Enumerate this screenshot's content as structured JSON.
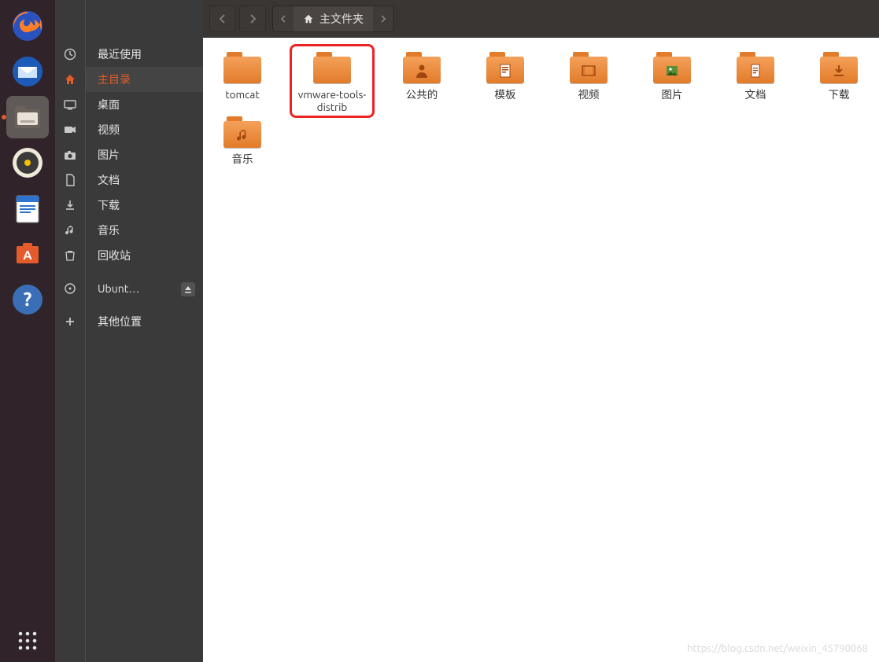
{
  "colors": {
    "accent": "#e25c26",
    "folder_light": "#f4a15a",
    "folder_dark": "#e27b2a",
    "highlight": "#ea2323"
  },
  "dock": [
    {
      "name": "firefox",
      "active": false,
      "running": false
    },
    {
      "name": "thunderbird",
      "active": false,
      "running": false
    },
    {
      "name": "files",
      "active": true,
      "running": true
    },
    {
      "name": "rhythmbox",
      "active": false,
      "running": false
    },
    {
      "name": "libreoffice-writer",
      "active": false,
      "running": false
    },
    {
      "name": "ubuntu-software",
      "active": false,
      "running": false
    },
    {
      "name": "help",
      "active": false,
      "running": false
    }
  ],
  "places": [
    {
      "icon": "clock",
      "label": "最近使用",
      "selected": false
    },
    {
      "icon": "home",
      "label": "主目录",
      "selected": true
    },
    {
      "icon": "desktop",
      "label": "桌面",
      "selected": false
    },
    {
      "icon": "video",
      "label": "视频",
      "selected": false
    },
    {
      "icon": "camera",
      "label": "图片",
      "selected": false
    },
    {
      "icon": "doc",
      "label": "文档",
      "selected": false
    },
    {
      "icon": "download",
      "label": "下载",
      "selected": false
    },
    {
      "icon": "music",
      "label": "音乐",
      "selected": false
    },
    {
      "icon": "trash",
      "label": "回收站",
      "selected": false
    },
    {
      "icon": "disc",
      "label": "Ubunt…",
      "selected": false,
      "ejectable": true
    },
    {
      "icon": "plus",
      "label": "其他位置",
      "selected": false
    }
  ],
  "toolbar": {
    "back_enabled": false,
    "forward_enabled": false
  },
  "breadcrumb": {
    "label": "主文件夹"
  },
  "files": [
    {
      "name": "tomcat",
      "variant": "plain",
      "highlighted": false
    },
    {
      "name": "vmware-tools-distrib",
      "variant": "plain",
      "highlighted": true
    },
    {
      "name": "公共的",
      "variant": "public",
      "highlighted": false
    },
    {
      "name": "模板",
      "variant": "template",
      "highlighted": false
    },
    {
      "name": "视频",
      "variant": "video",
      "highlighted": false
    },
    {
      "name": "图片",
      "variant": "picture",
      "highlighted": false
    },
    {
      "name": "文档",
      "variant": "doc",
      "highlighted": false
    },
    {
      "name": "下载",
      "variant": "download",
      "highlighted": false
    },
    {
      "name": "音乐",
      "variant": "music",
      "highlighted": false
    }
  ],
  "watermark": "https://blog.csdn.net/weixin_45790068"
}
